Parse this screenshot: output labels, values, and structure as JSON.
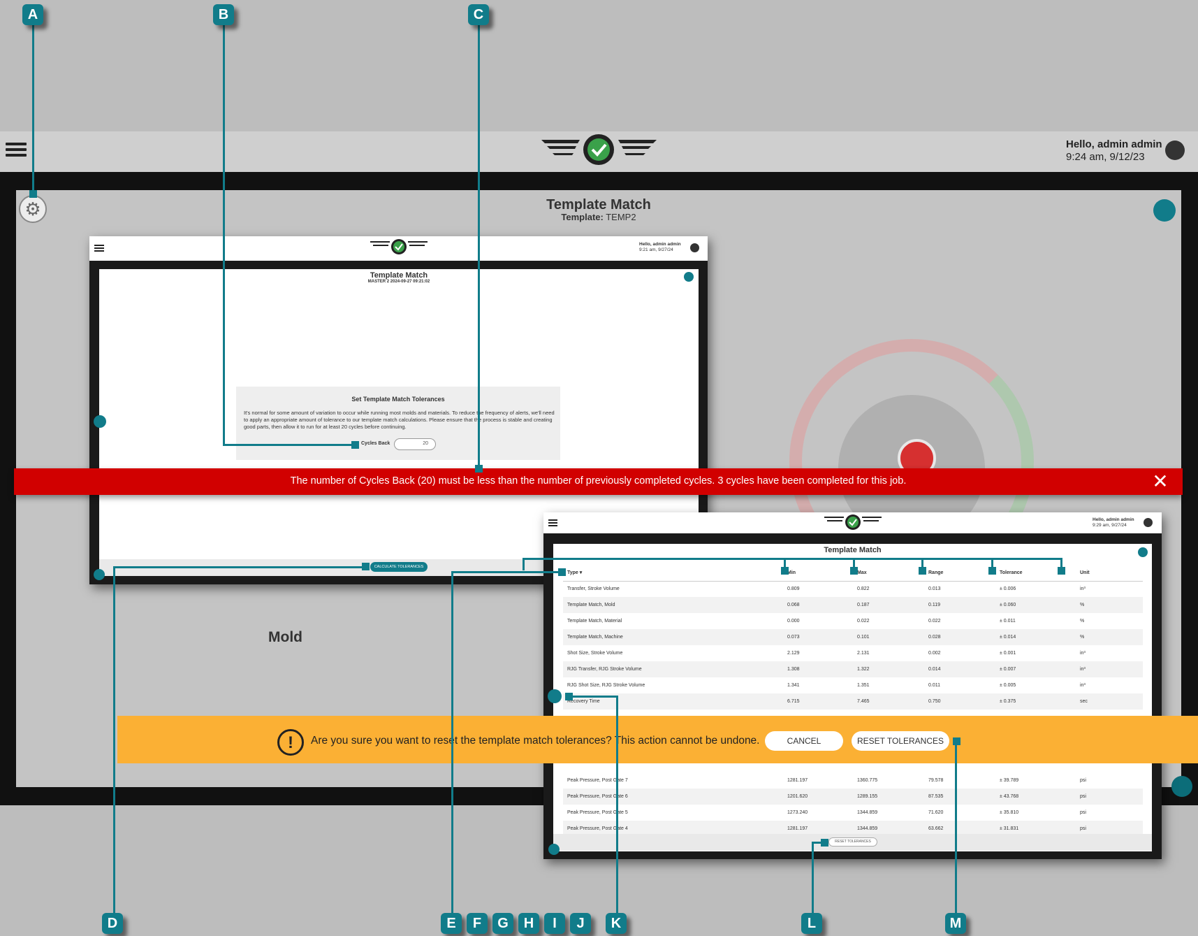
{
  "app": {
    "user_greeting": "Hello, admin admin",
    "datetime": "9:24 am, 9/12/23",
    "title": "Template Match",
    "template_label": "Template:",
    "template_value": "TEMP2",
    "mold_label": "Mold"
  },
  "screenshot1": {
    "greeting": "Hello, admin admin",
    "datetime": "9:21 am, 9/27/24",
    "title": "Template Match",
    "subtitle": "MASTER 2   2024-09-27   09:21:02",
    "tol_heading": "Set Template Match Tolerances",
    "tol_text": "It's normal for some amount of variation to occur while running most molds and materials. To reduce the frequency of alerts, we'll need to apply an appropriate amount of tolerance to our template match calculations. Please ensure that the process is stable and creating good parts, then allow it to run for at least 20 cycles before continuing.",
    "cycles_back_label": "Cycles Back",
    "cycles_back_value": "20",
    "calc_button": "CALCULATE TOLERANCES"
  },
  "error_banner": {
    "text": "The number of Cycles Back (20) must be less than the number of previously completed cycles. 3 cycles have been completed for this job."
  },
  "screenshot2": {
    "greeting": "Hello, admin admin",
    "datetime": "9:29 am, 9/27/24",
    "title": "Template Match",
    "columns": [
      "Type ▾",
      "Min",
      "Max",
      "Range",
      "Tolerance",
      "Unit"
    ],
    "rows": [
      [
        "Transfer, Stroke Volume",
        "0.809",
        "0.822",
        "0.013",
        "± 0.006",
        "in³"
      ],
      [
        "Template Match, Mold",
        "0.068",
        "0.187",
        "0.119",
        "± 0.060",
        "%"
      ],
      [
        "Template Match, Material",
        "0.000",
        "0.022",
        "0.022",
        "± 0.011",
        "%"
      ],
      [
        "Template Match, Machine",
        "0.073",
        "0.101",
        "0.028",
        "± 0.014",
        "%"
      ],
      [
        "Shot Size, Stroke Volume",
        "2.129",
        "2.131",
        "0.002",
        "± 0.001",
        "in³"
      ],
      [
        "RJG Transfer, RJG Stroke Volume",
        "1.308",
        "1.322",
        "0.014",
        "± 0.007",
        "in³"
      ],
      [
        "RJG Shot Size, RJG Stroke Volume",
        "1.341",
        "1.351",
        "0.011",
        "± 0.005",
        "in³"
      ],
      [
        "Recovery Time",
        "6.715",
        "7.465",
        "0.750",
        "± 0.375",
        "sec"
      ]
    ],
    "rows_bottom": [
      [
        "Peak Pressure, Post Gate 7",
        "1281.197",
        "1360.775",
        "79.578",
        "± 39.789",
        "psi"
      ],
      [
        "Peak Pressure, Post Gate 6",
        "1201.620",
        "1289.155",
        "87.535",
        "± 43.768",
        "psi"
      ],
      [
        "Peak Pressure, Post Gate 5",
        "1273.240",
        "1344.859",
        "71.620",
        "± 35.810",
        "psi"
      ],
      [
        "Peak Pressure, Post Gate 4",
        "1281.197",
        "1344.859",
        "63.662",
        "± 31.831",
        "psi"
      ]
    ],
    "reset_button": "RESET TOLERANCES"
  },
  "confirm_banner": {
    "text": "Are you sure you want to reset the template match tolerances? This action cannot be undone.",
    "cancel": "CANCEL",
    "reset": "RESET TOLERANCES"
  },
  "callouts": [
    "A",
    "B",
    "C",
    "D",
    "E",
    "F",
    "G",
    "H",
    "I",
    "J",
    "K",
    "L",
    "M"
  ],
  "colors": {
    "teal": "#117c8a",
    "error_red": "#d10000",
    "warning_orange": "#fbb034"
  }
}
